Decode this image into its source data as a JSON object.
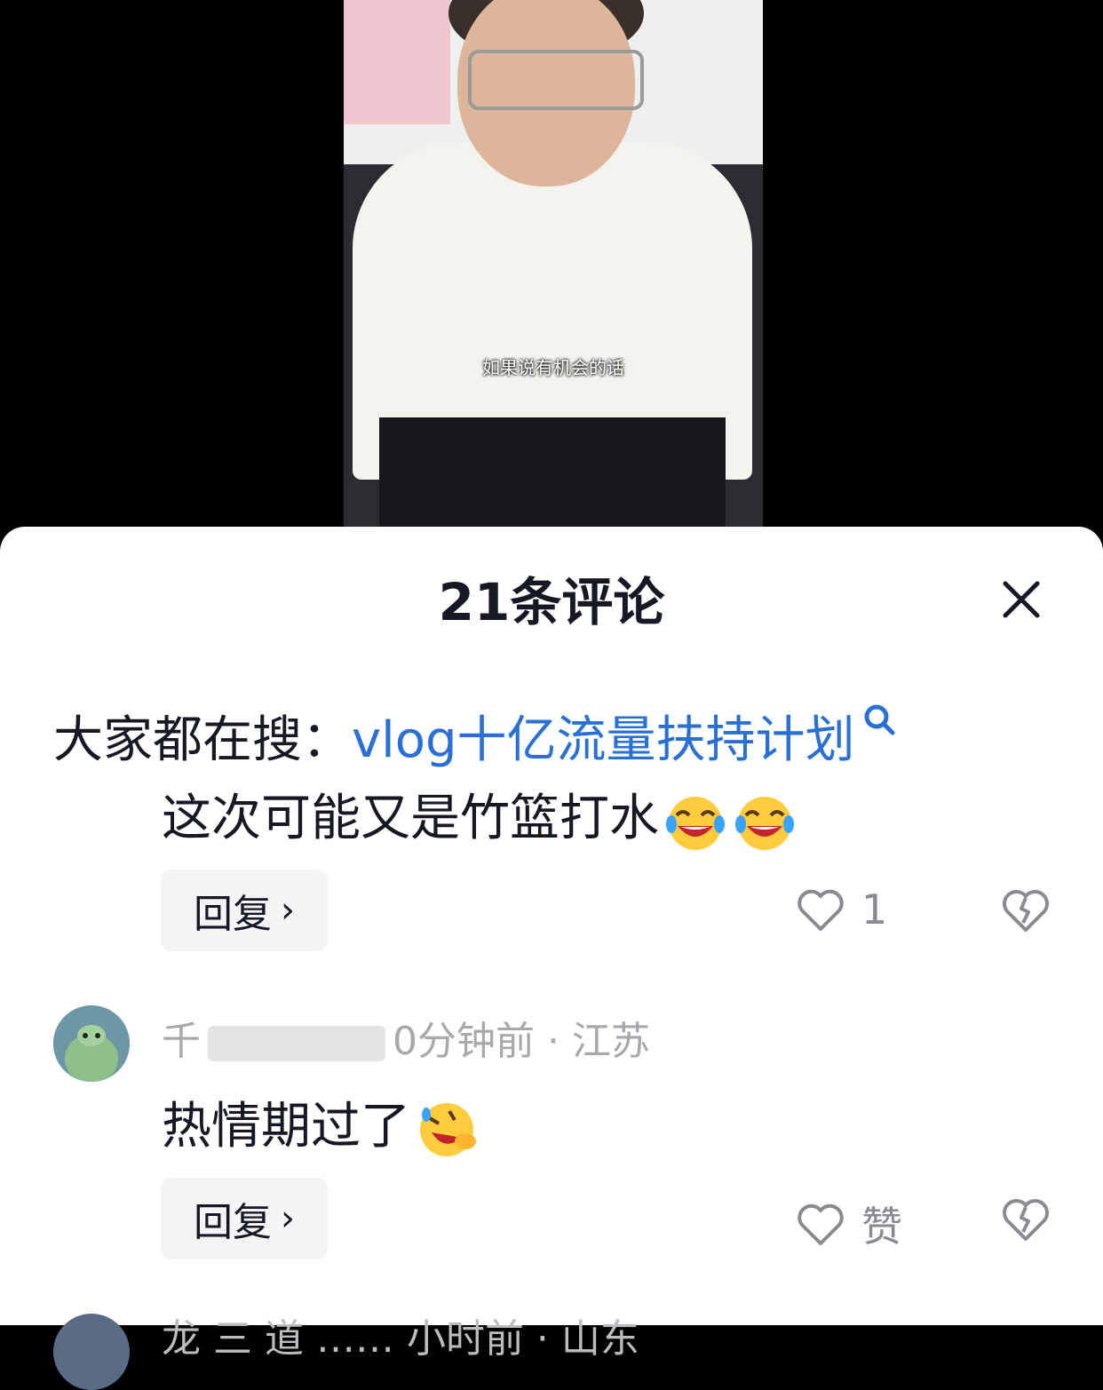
{
  "video": {
    "subtitle": "如果说有机会的话"
  },
  "sheet": {
    "title": "21条评论"
  },
  "search_hint": {
    "prefix": "大家都在搜：",
    "link": "vlog十亿流量扶持计划"
  },
  "comments": [
    {
      "text": "这次可能又是竹篮打水",
      "reply_label": "回复",
      "like_count": "1"
    },
    {
      "meta_prefix": "千",
      "meta_suffix": "0分钟前 · 江苏",
      "text": "热情期过了",
      "reply_label": "回复",
      "like_label": "赞"
    }
  ],
  "next_comment": {
    "meta_partial": "龙    三    道    ……    小时前 · 山东"
  }
}
